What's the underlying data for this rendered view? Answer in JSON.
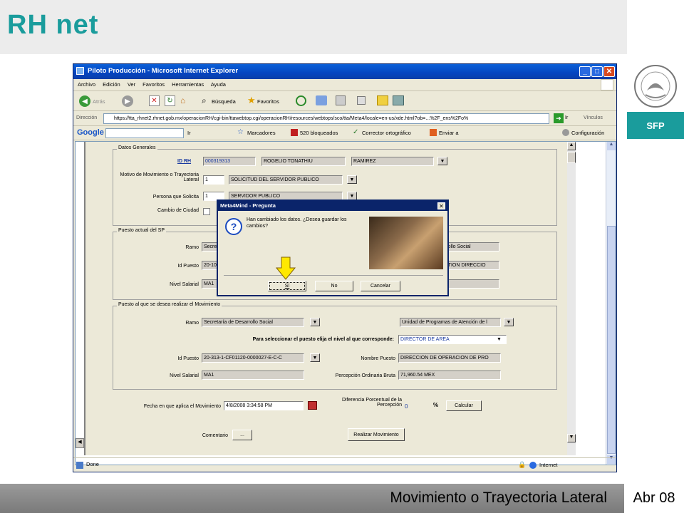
{
  "slide": {
    "title": "RH net",
    "footer_text": "Movimiento o Trayectoria Lateral",
    "footer_date": "Abr 08",
    "sfp": "SFP"
  },
  "browser": {
    "title": "Piloto Producción - Microsoft Internet Explorer",
    "menu": [
      "Archivo",
      "Edición",
      "Ver",
      "Favoritos",
      "Herramientas",
      "Ayuda"
    ],
    "toolbar": {
      "back": "Atrás",
      "search": "Búsqueda",
      "favorites": "Favoritos"
    },
    "address_label": "Dirección",
    "address": "https://tta_rhnet2.rhnet.gob.mx/operacionRH/cgi-bin/ttawebtop.cgi/operacionRH/resources/webtops/sco/tta/Meta4/locale=en-us/xde.html?ob=...%2F_ens%2Fo%",
    "go": "Ir",
    "links": "Vínculos",
    "google": {
      "label": "Google",
      "go": "Ir",
      "bookmarks": "Marcadores",
      "blocked": "520 bloqueados",
      "spell": "Corrector ortográfico",
      "send": "Enviar a",
      "settings": "Configuración"
    },
    "status_done": "Done",
    "status_zone": "Internet"
  },
  "form": {
    "general": {
      "legend": "Datos Generales",
      "id_label": "ID RH",
      "id_value": "000319313",
      "name1": "ROGELIO TONATHIU",
      "name2": "RAMIREZ",
      "motivo_label": "Motivo  de Movimiento o Trayectoria Lateral",
      "motivo_code": "1",
      "motivo_value": "SOLICITUD DEL SERVIDOR PUBLICO",
      "solicita_label": "Persona que Solicita",
      "solicita_code": "1",
      "solicita_value": "SERVIDOR PUBLICO",
      "ciudad_label": "Cambio de Ciudad"
    },
    "actual": {
      "legend": "Puesto actual del SP",
      "ramo_label": "Ramo",
      "ramo_value": "Secre",
      "ur_value": "rrollo Social",
      "idpuesto_label": "Id Puesto",
      "idpuesto_value": "20-10",
      "nombre_value": "STION DIRECCIO",
      "nivel_label": "Nivel Salarial",
      "nivel_value": "MA1"
    },
    "destino": {
      "legend": "Puesto al que se desea realizar el Movimiento",
      "ramo_label": "Ramo",
      "ramo_value": "Secretaría de Desarrollo Social",
      "ur_label": "UR",
      "ur_value": "Unidad de Programas de Atención de l",
      "nivel_prompt": "Para seleccionar el puesto elija el nivel al que corresponde:",
      "nivel_select": "DIRECTOR DE AREA",
      "idpuesto_label": "Id Puesto",
      "idpuesto_value": "20-313-1-CF01120-0000027-E-C-C",
      "nombre_label": "Nombre Puesto",
      "nombre_value": "DIRECCION DE OPERACION DE PRO",
      "nivel_label": "Nivel Salarial",
      "nivel_value": "MA1",
      "percepcion_label": "Percepción Ordinaria Bruta",
      "percepcion_value": "71,960.54 MEX"
    },
    "fecha_label": "Fecha en que aplica el Movimiento",
    "fecha_value": "4/8/2008 3:34:58 PM",
    "diferencia_label": "Diferencia Porcentual de la Percepción",
    "diferencia_value": "0",
    "percent": "%",
    "calcular": "Calcular",
    "comentario_label": "Comentario",
    "comentario_btn": "...",
    "realizar": "Realizar Movimiento"
  },
  "dialog": {
    "title": "Meta4Mind - Pregunta",
    "message": "Han cambiado los datos. ¿Desea guardar los cambios?",
    "yes": "Sí",
    "no": "No",
    "cancel": "Cancelar"
  }
}
